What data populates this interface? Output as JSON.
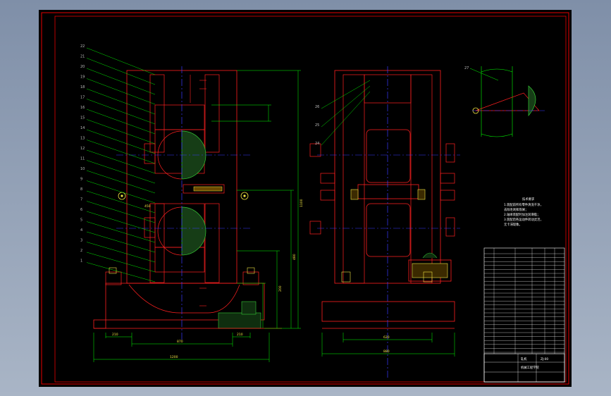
{
  "app": {
    "name": "CAD drawing viewer"
  },
  "colors": {
    "background": "#000000",
    "frame": "#e60000",
    "part_lines": "#ff2020",
    "dimension_lines": "#00ff00",
    "center_lines": "#3a3aff",
    "hatch": "#35c935",
    "leaders": "#00ff00"
  },
  "drawing": {
    "front_view": {
      "part_numbers": [
        "22",
        "21",
        "20",
        "19",
        "18",
        "17",
        "16",
        "15",
        "14",
        "13",
        "12",
        "11",
        "10",
        "9",
        "8",
        "7",
        "6",
        "5",
        "4",
        "3",
        "2",
        "1"
      ],
      "dimensions": {
        "overall_width": "1200",
        "base_width": "870",
        "left_pad": "210",
        "right_pad": "210",
        "bore_offset": "450",
        "right_height_1": "1100",
        "right_height_2": "480",
        "right_height_3": "200"
      }
    },
    "side_view": {
      "part_numbers": [
        "26",
        "25",
        "24"
      ],
      "dimensions": {
        "inner_width": "620",
        "overall_width": "880"
      }
    },
    "detail": {
      "part_number": "27"
    },
    "technical_requirements": {
      "title": "技术要求",
      "lines": [
        "1.装配前所有零件清洗干净，",
        "  去除毛刺和铁屑；",
        "2.轴承装配时加注润滑脂；",
        "3.装配后各运动件转动灵活，",
        "  无卡滞现象。"
      ]
    },
    "title_block": {
      "drawing_name": "轧机",
      "drawing_code": "ZJ-00",
      "school": "机械工程学院"
    }
  }
}
